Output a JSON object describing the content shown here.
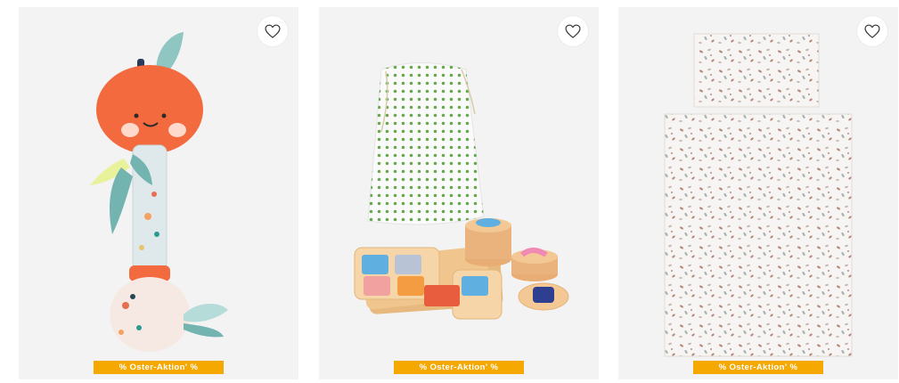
{
  "products": [
    {
      "badge": {
        "text": "% Oster-Aktion' %"
      }
    },
    {
      "badge": {
        "text": "% Oster-Aktion' %"
      }
    },
    {
      "badge": {
        "text": "% Oster-Aktion' %"
      }
    }
  ],
  "colors": {
    "badge": "#f5a800",
    "card_bg": "#f3f3f3",
    "heart_stroke": "#333333"
  },
  "icons": {
    "favorite": "heart-outline-icon"
  }
}
